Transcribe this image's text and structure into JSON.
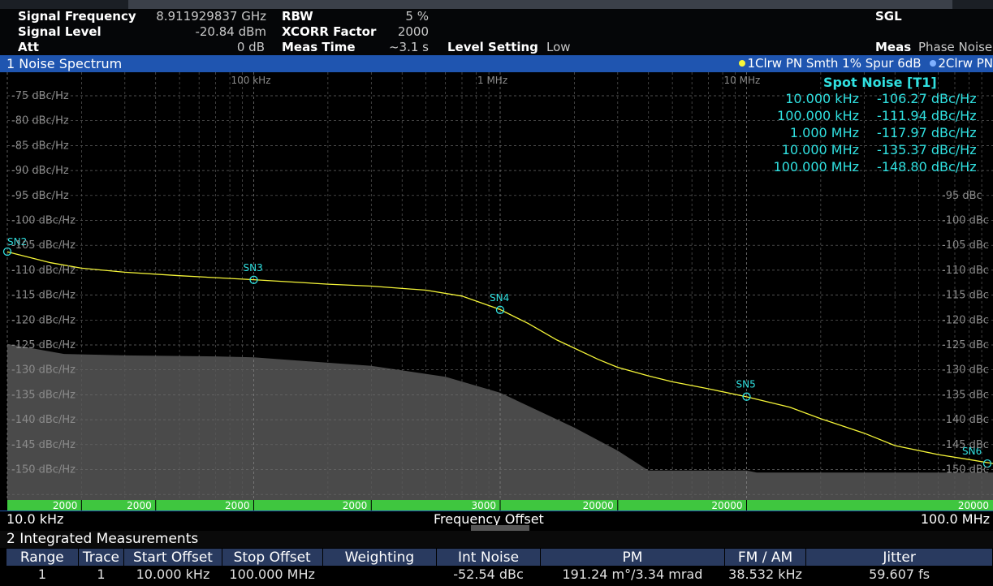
{
  "header": {
    "signal_frequency": {
      "label": "Signal Frequency",
      "value": "8.911929837 GHz"
    },
    "signal_level": {
      "label": "Signal Level",
      "value": "-20.84 dBm"
    },
    "att": {
      "label": "Att",
      "value": "0 dB"
    },
    "rbw": {
      "label": "RBW",
      "value": "5 %"
    },
    "xcorr": {
      "label": "XCORR Factor",
      "value": "2000"
    },
    "meas_time": {
      "label": "Meas Time",
      "value": "~3.1 s"
    },
    "level_setting": {
      "label": "Level Setting",
      "value": "Low"
    },
    "sweep_mode": "SGL",
    "meas": {
      "label": "Meas",
      "value": "Phase Noise"
    }
  },
  "panel": {
    "title": "1 Noise Spectrum",
    "trace1": "1Clrw PN Smth 1% Spur 6dB",
    "trace2": "2Clrw PN",
    "trace1_color": "#f5f538",
    "trace2_color": "#7fb0ff"
  },
  "spot_noise": {
    "title": "Spot Noise [T1]",
    "rows": [
      {
        "freq": "10.000 kHz",
        "value": "-106.27 dBc/Hz"
      },
      {
        "freq": "100.000 kHz",
        "value": "-111.94 dBc/Hz"
      },
      {
        "freq": "1.000 MHz",
        "value": "-117.97 dBc/Hz"
      },
      {
        "freq": "10.000 MHz",
        "value": "-135.37 dBc/Hz"
      },
      {
        "freq": "100.000 MHz",
        "value": "-148.80 dBc/Hz"
      }
    ]
  },
  "chart_data": {
    "type": "line",
    "xscale": "log",
    "xlim_hz": [
      10000,
      100000000
    ],
    "ylim": [
      -155,
      -72
    ],
    "y_ticks_left": [
      "-75 dBc/Hz",
      "-80 dBc/Hz",
      "-85 dBc/Hz",
      "-90 dBc/Hz",
      "-95 dBc/Hz",
      "-100 dBc/Hz",
      "-105 dBc/Hz",
      "-110 dBc/Hz",
      "-115 dBc/Hz",
      "-120 dBc/Hz",
      "-125 dBc/Hz",
      "-130 dBc/Hz",
      "-135 dBc/Hz",
      "-140 dBc/Hz",
      "-145 dBc/Hz",
      "-150 dBc/Hz"
    ],
    "y_ticks_right": [
      "-95 dBc",
      "-100 dBc",
      "-105 dBc",
      "-110 dBc",
      "-115 dBc",
      "-120 dBc",
      "-125 dBc",
      "-130 dBc",
      "-135 dBc",
      "-140 dBc",
      "-145 dBc",
      "-150 dBc"
    ],
    "x_tick_labels": [
      "100 kHz",
      "1 MHz",
      "10 MHz"
    ],
    "decade_freqs": [
      100000,
      1000000,
      10000000
    ],
    "series": [
      {
        "values_hz": [
          10000,
          15000,
          20000,
          30000,
          50000,
          70000,
          100000,
          200000,
          300000,
          500000,
          700000,
          1000000,
          1300000,
          1700000,
          2500000,
          3000000,
          4000000,
          5000000,
          7000000,
          10000000,
          15000000,
          20000000,
          30000000,
          40000000,
          60000000,
          80000000,
          100000000
        ],
        "values_dbc": [
          -106.3,
          -108.5,
          -109.6,
          -110.4,
          -111.1,
          -111.5,
          -111.9,
          -112.8,
          -113.2,
          -114.0,
          -115.2,
          -117.9,
          -120.7,
          -124.0,
          -127.9,
          -129.5,
          -131.2,
          -132.4,
          -133.8,
          -135.4,
          -137.5,
          -139.8,
          -142.7,
          -145.2,
          -147.0,
          -148.0,
          -148.8
        ]
      }
    ],
    "xcorr_gain_band": {
      "hz": [
        10000,
        17000,
        30000,
        70000,
        100000,
        300000,
        600000,
        1000000,
        2000000,
        3000000,
        4000000,
        10000000,
        11000000,
        100000000
      ],
      "dbc": [
        -124.8,
        -126.8,
        -127.1,
        -127.3,
        -127.5,
        -129.2,
        -131.4,
        -134.6,
        -141.6,
        -146.2,
        -150.2,
        -150.2,
        -150.6,
        -150.6
      ]
    },
    "markers": [
      {
        "label": "SN2",
        "hz": 10000,
        "dbc": -106.27
      },
      {
        "label": "SN3",
        "hz": 100000,
        "dbc": -111.94
      },
      {
        "label": "SN4",
        "hz": 1000000,
        "dbc": -117.97
      },
      {
        "label": "SN5",
        "hz": 10000000,
        "dbc": -135.37
      },
      {
        "label": "SN6",
        "hz": 100000000,
        "dbc": -148.8
      }
    ],
    "segment_labels": [
      "2000",
      "2000",
      "2000",
      "2000",
      "3000",
      "20000",
      "20000",
      "20000"
    ],
    "xlabel": "Frequency Offset",
    "x_start": "10.0 kHz",
    "x_stop": "100.0 MHz"
  },
  "integrated": {
    "title": "2 Integrated Measurements",
    "columns": [
      "Range",
      "Trace",
      "Start Offset",
      "Stop Offset",
      "Weighting",
      "Int Noise",
      "PM",
      "FM / AM",
      "Jitter"
    ],
    "rows": [
      [
        "1",
        "1",
        "10.000 kHz",
        "100.000 MHz",
        "",
        "-52.54 dBc",
        "191.24 m°/3.34 mrad",
        "38.532 kHz",
        "59.607 fs"
      ]
    ]
  }
}
